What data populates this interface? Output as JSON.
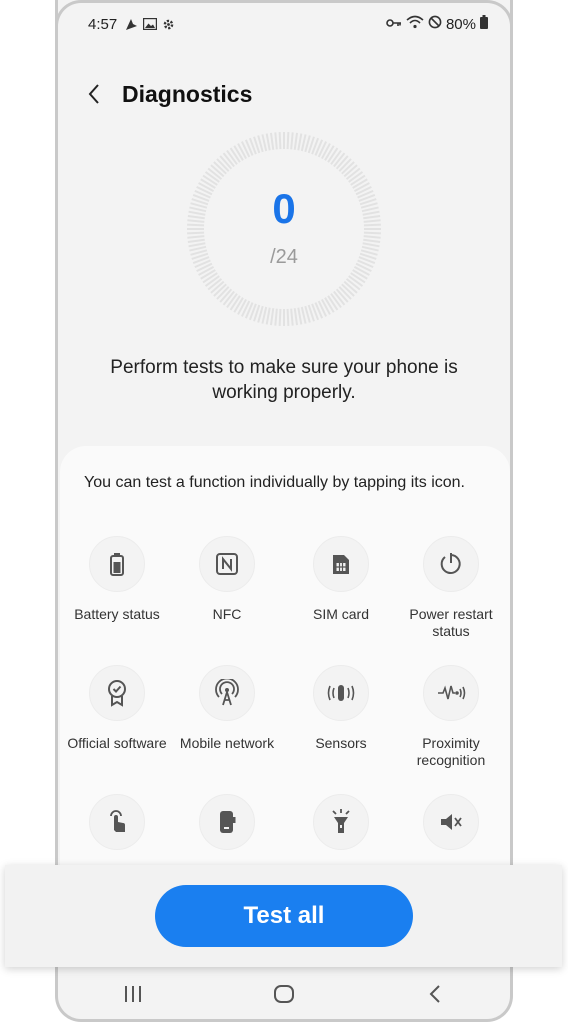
{
  "status_bar": {
    "time": "4:57",
    "battery_percent": "80%",
    "left_icons": [
      "navigation-icon",
      "gallery-icon",
      "settings-icon"
    ],
    "right_icons": [
      "vpn-key-icon",
      "wifi-icon",
      "do-not-disturb-icon",
      "battery-icon"
    ]
  },
  "header": {
    "title": "Diagnostics"
  },
  "progress": {
    "completed": "0",
    "total": "/24"
  },
  "intro_text": "Perform tests to make sure your phone is working properly.",
  "card": {
    "hint": "You can test a function individually by tapping its icon.",
    "items": [
      {
        "label": "Battery status",
        "icon": "battery-icon"
      },
      {
        "label": "NFC",
        "icon": "nfc-icon"
      },
      {
        "label": "SIM card",
        "icon": "sim-card-icon"
      },
      {
        "label": "Power restart status",
        "icon": "power-restart-icon"
      },
      {
        "label": "Official software",
        "icon": "official-software-badge-icon"
      },
      {
        "label": "Mobile network",
        "icon": "mobile-network-antenna-icon"
      },
      {
        "label": "Sensors",
        "icon": "sensors-vibration-icon"
      },
      {
        "label": "Proximity recognition",
        "icon": "proximity-wave-icon"
      },
      {
        "label": "",
        "icon": "touch-screen-icon"
      },
      {
        "label": "",
        "icon": "phone-side-icon"
      },
      {
        "label": "",
        "icon": "flashlight-icon"
      },
      {
        "label": "",
        "icon": "speaker-muted-icon"
      }
    ]
  },
  "actions": {
    "test_all": "Test all"
  },
  "nav_bar": {
    "buttons": [
      "recent-apps-icon",
      "home-icon",
      "back-icon"
    ]
  },
  "colors": {
    "accent": "#1a7ff0",
    "count": "#1a74e8",
    "background": "#f3f3f3"
  }
}
